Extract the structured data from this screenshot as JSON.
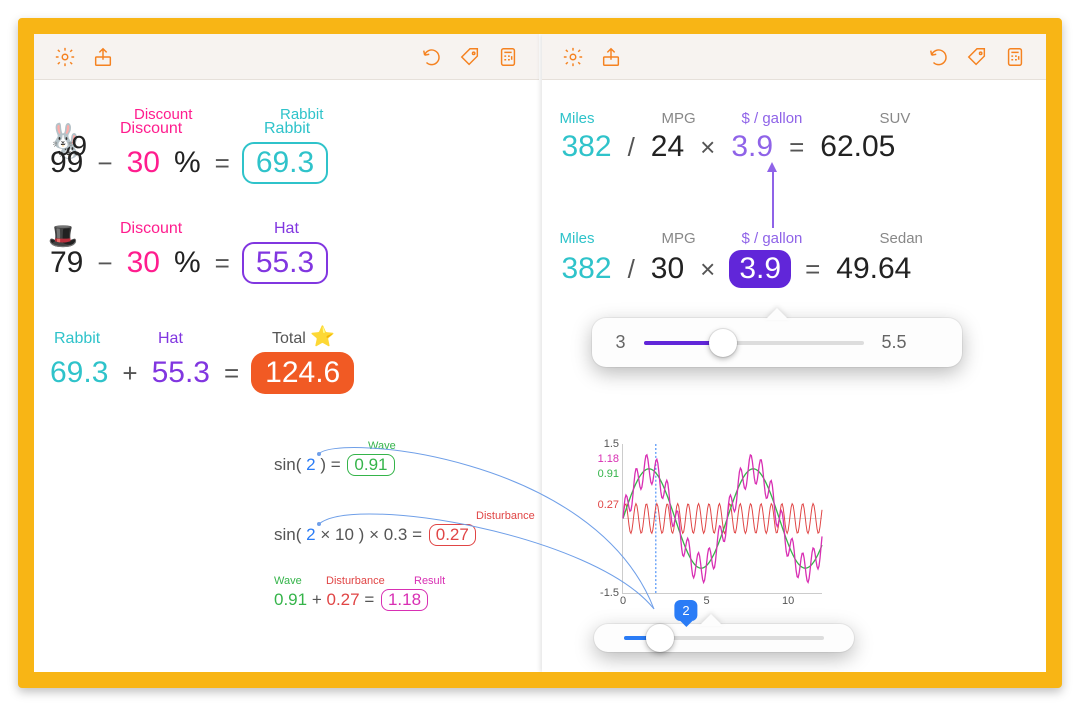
{
  "colors": {
    "orange": "#f58220",
    "pink": "#ff1d8e",
    "teal": "#2fc3ca",
    "purple": "#8136e0",
    "deep_purple": "#6126d9",
    "blue": "#2a7cf6",
    "green": "#35b44a",
    "red": "#e04545",
    "magenta": "#d82fb3"
  },
  "left": {
    "row1": {
      "emoji": "🐰",
      "a": "99",
      "op1": "−",
      "b": "30",
      "pct": "%",
      "eq": "=",
      "a_label": "",
      "b_label": "Discount",
      "res_label": "Rabbit",
      "res": "69.3"
    },
    "row2": {
      "emoji": "🎩",
      "a": "79",
      "op1": "−",
      "b": "30",
      "pct": "%",
      "eq": "=",
      "b_label": "Discount",
      "res_label": "Hat",
      "res": "55.3"
    },
    "row3": {
      "a": "69.3",
      "op1": "+",
      "b": "55.3",
      "eq": "=",
      "a_label": "Rabbit",
      "b_label": "Hat",
      "res_label": "Total",
      "res": "124.6",
      "star": "⭐"
    }
  },
  "right": {
    "row1": {
      "labels": {
        "miles": "Miles",
        "mpg": "MPG",
        "price": "$ / gallon",
        "car": "SUV"
      },
      "miles": "382",
      "div": "/",
      "mpg": "24",
      "mul": "×",
      "price": "3.9",
      "eq": "=",
      "result": "62.05"
    },
    "row2": {
      "labels": {
        "miles": "Miles",
        "mpg": "MPG",
        "price": "$ / gallon",
        "car": "Sedan"
      },
      "miles": "382",
      "div": "/",
      "mpg": "30",
      "mul": "×",
      "price": "3.9",
      "eq": "=",
      "result": "49.64"
    },
    "slider": {
      "min": "3",
      "max": "5.5",
      "value": "3.9",
      "fill_pct": 36
    }
  },
  "bottom": {
    "e1": {
      "fn": "sin(",
      "x": "2",
      "close": " )",
      "eq": " = ",
      "label": "Wave",
      "res": "0.91"
    },
    "e2": {
      "fn": "sin(",
      "x": "2",
      "mul": " × ",
      "k": "10",
      "close": " )",
      "mul2": " × ",
      "amp": "0.3",
      "eq": " = ",
      "label": "Disturbance",
      "res": "0.27"
    },
    "e3": {
      "a": "0.91",
      "plus": " + ",
      "b": "0.27",
      "eq": " = ",
      "a_label": "Wave",
      "b_label": "Disturbance",
      "res_label": "Result",
      "res": "1.18"
    },
    "slider_value": "2"
  },
  "chart_data": {
    "type": "line",
    "xlim": [
      0,
      12
    ],
    "ylim": [
      -1.5,
      1.5
    ],
    "xticks": [
      0,
      5,
      10
    ],
    "yticks": [
      -1.5,
      1.5
    ],
    "ref_lines": [
      {
        "label": "1.18",
        "y": 1.18,
        "color": "#d82fb3"
      },
      {
        "label": "0.91",
        "y": 0.91,
        "color": "#35b44a"
      },
      {
        "label": "0.27",
        "y": 0.27,
        "color": "#e04545"
      }
    ],
    "cursor_x": 2,
    "series": [
      {
        "name": "Disturbance",
        "color": "#e04545",
        "fn": "0.3*sin(10x)"
      },
      {
        "name": "Wave",
        "color": "#35b44a",
        "fn": "sin(x)"
      },
      {
        "name": "Result",
        "color": "#d82fb3",
        "fn": "sin(x)+0.3*sin(10x)"
      }
    ]
  }
}
